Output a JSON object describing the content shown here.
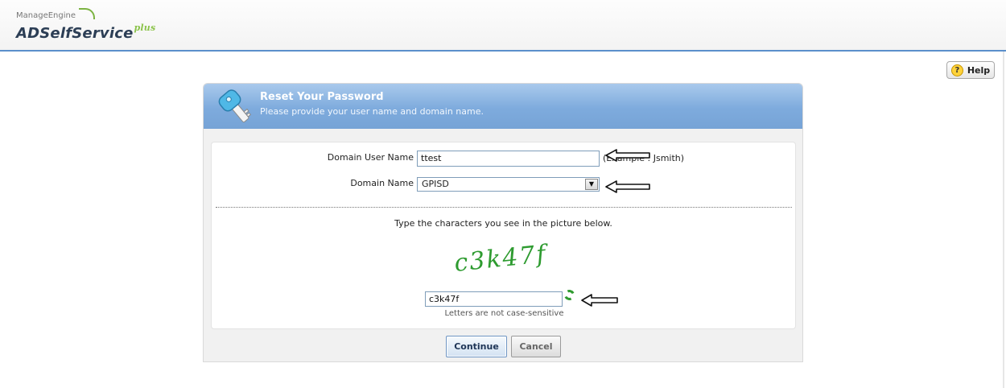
{
  "header": {
    "logo_top": "ManageEngine",
    "logo_main": "ADSelfService",
    "logo_suffix": "plus"
  },
  "help": {
    "label": "Help",
    "icon": "help-question-icon"
  },
  "panel": {
    "title": "Reset Your Password",
    "subtitle": "Please provide your user name and domain name.",
    "icon": "key-icon"
  },
  "form": {
    "username_label": "Domain User Name",
    "username_value": "ttest",
    "username_example": "(Example : Jsmith)",
    "domain_label": "Domain Name",
    "domain_value": "GPISD"
  },
  "captcha": {
    "instruction": "Type the characters you see in the picture below.",
    "image_text": "c3k47f",
    "input_value": "c3k47f",
    "hint": "Letters are not case-sensitive",
    "refresh_icon": "refresh-icon"
  },
  "buttons": {
    "continue": "Continue",
    "cancel": "Cancel"
  },
  "annotations": {
    "arrow_icon": "left-arrow-icon",
    "count": 3
  },
  "colors": {
    "header_rule": "#5b8fcb",
    "panel_header": "#7eabdd",
    "captcha_text": "#2e9b30"
  }
}
